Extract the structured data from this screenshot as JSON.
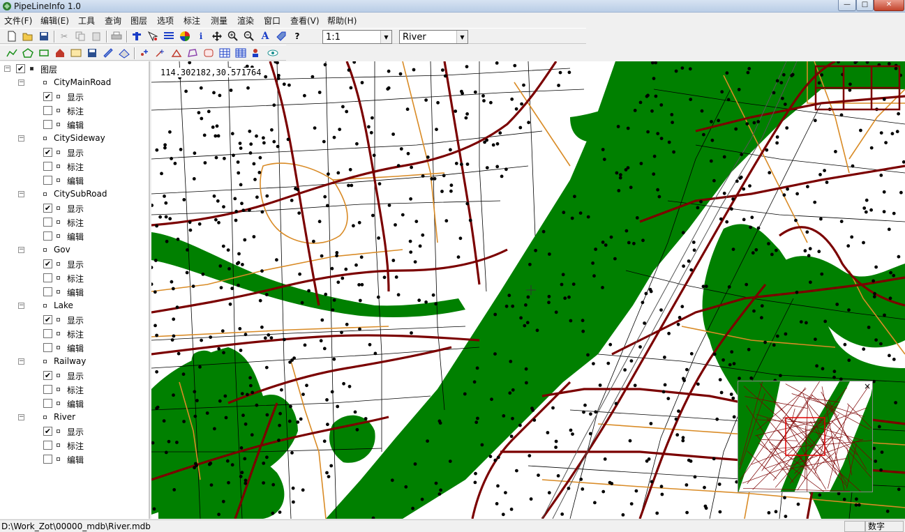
{
  "window": {
    "title": "PipeLineInfo 1.0",
    "controls": {
      "minimize": "—",
      "maximize": "□",
      "close": "✕"
    }
  },
  "menu": [
    "文件(F)",
    "编辑(E)",
    "工具",
    "查询",
    "图层",
    "选项",
    "标注",
    "测量",
    "渲染",
    "窗口",
    "查看(V)",
    "帮助(H)"
  ],
  "toolbar": {
    "scale_value": "1:1",
    "layer_value": "River"
  },
  "layer_tree": {
    "root_label": "图层",
    "root_checked": true,
    "layers": [
      {
        "name": "CityMainRoad",
        "display": true,
        "label": false,
        "edit": false
      },
      {
        "name": "CitySideway",
        "display": true,
        "label": false,
        "edit": false
      },
      {
        "name": "CitySubRoad",
        "display": true,
        "label": false,
        "edit": false
      },
      {
        "name": "Gov",
        "display": true,
        "label": false,
        "edit": false
      },
      {
        "name": "Lake",
        "display": true,
        "label": false,
        "edit": false
      },
      {
        "name": "Railway",
        "display": true,
        "label": false,
        "edit": false
      },
      {
        "name": "River",
        "display": true,
        "label": false,
        "edit": false
      }
    ],
    "sub_labels": {
      "display": "显示",
      "label": "标注",
      "edit": "编辑"
    }
  },
  "map": {
    "coordinate_readout": "114.302182,30.571764",
    "colors": {
      "river": "#008000",
      "main_road": "#7b0000",
      "sub_road": "#d98b26",
      "sideway": "#000000",
      "gov": "#000000",
      "overview_extent": "#e00000"
    },
    "overview_close": "×"
  },
  "status": {
    "path": "D:\\Work_Zot\\00000_mdb\\River.mdb",
    "mode": "数字"
  }
}
